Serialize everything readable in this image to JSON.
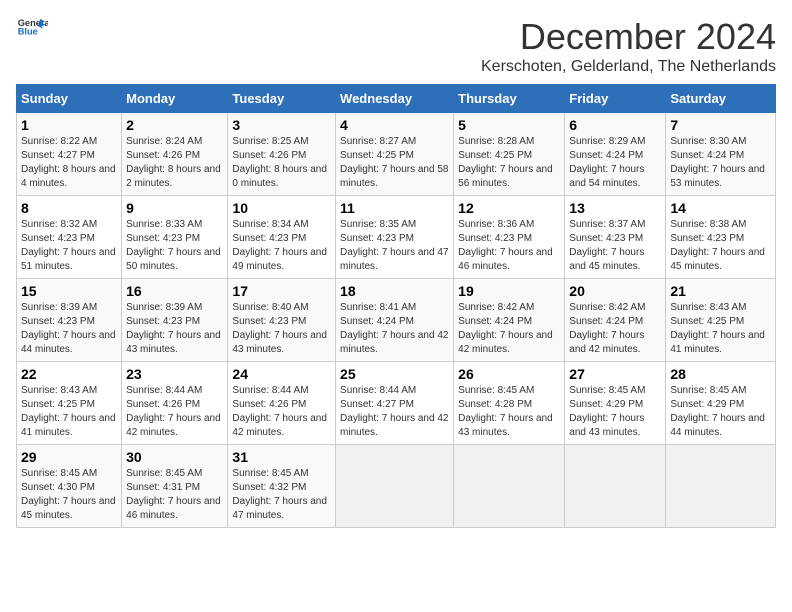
{
  "header": {
    "logo_general": "General",
    "logo_blue": "Blue",
    "title": "December 2024",
    "subtitle": "Kerschoten, Gelderland, The Netherlands"
  },
  "days_of_week": [
    "Sunday",
    "Monday",
    "Tuesday",
    "Wednesday",
    "Thursday",
    "Friday",
    "Saturday"
  ],
  "weeks": [
    [
      {
        "day": "1",
        "sunrise": "Sunrise: 8:22 AM",
        "sunset": "Sunset: 4:27 PM",
        "daylight": "Daylight: 8 hours and 4 minutes."
      },
      {
        "day": "2",
        "sunrise": "Sunrise: 8:24 AM",
        "sunset": "Sunset: 4:26 PM",
        "daylight": "Daylight: 8 hours and 2 minutes."
      },
      {
        "day": "3",
        "sunrise": "Sunrise: 8:25 AM",
        "sunset": "Sunset: 4:26 PM",
        "daylight": "Daylight: 8 hours and 0 minutes."
      },
      {
        "day": "4",
        "sunrise": "Sunrise: 8:27 AM",
        "sunset": "Sunset: 4:25 PM",
        "daylight": "Daylight: 7 hours and 58 minutes."
      },
      {
        "day": "5",
        "sunrise": "Sunrise: 8:28 AM",
        "sunset": "Sunset: 4:25 PM",
        "daylight": "Daylight: 7 hours and 56 minutes."
      },
      {
        "day": "6",
        "sunrise": "Sunrise: 8:29 AM",
        "sunset": "Sunset: 4:24 PM",
        "daylight": "Daylight: 7 hours and 54 minutes."
      },
      {
        "day": "7",
        "sunrise": "Sunrise: 8:30 AM",
        "sunset": "Sunset: 4:24 PM",
        "daylight": "Daylight: 7 hours and 53 minutes."
      }
    ],
    [
      {
        "day": "8",
        "sunrise": "Sunrise: 8:32 AM",
        "sunset": "Sunset: 4:23 PM",
        "daylight": "Daylight: 7 hours and 51 minutes."
      },
      {
        "day": "9",
        "sunrise": "Sunrise: 8:33 AM",
        "sunset": "Sunset: 4:23 PM",
        "daylight": "Daylight: 7 hours and 50 minutes."
      },
      {
        "day": "10",
        "sunrise": "Sunrise: 8:34 AM",
        "sunset": "Sunset: 4:23 PM",
        "daylight": "Daylight: 7 hours and 49 minutes."
      },
      {
        "day": "11",
        "sunrise": "Sunrise: 8:35 AM",
        "sunset": "Sunset: 4:23 PM",
        "daylight": "Daylight: 7 hours and 47 minutes."
      },
      {
        "day": "12",
        "sunrise": "Sunrise: 8:36 AM",
        "sunset": "Sunset: 4:23 PM",
        "daylight": "Daylight: 7 hours and 46 minutes."
      },
      {
        "day": "13",
        "sunrise": "Sunrise: 8:37 AM",
        "sunset": "Sunset: 4:23 PM",
        "daylight": "Daylight: 7 hours and 45 minutes."
      },
      {
        "day": "14",
        "sunrise": "Sunrise: 8:38 AM",
        "sunset": "Sunset: 4:23 PM",
        "daylight": "Daylight: 7 hours and 45 minutes."
      }
    ],
    [
      {
        "day": "15",
        "sunrise": "Sunrise: 8:39 AM",
        "sunset": "Sunset: 4:23 PM",
        "daylight": "Daylight: 7 hours and 44 minutes."
      },
      {
        "day": "16",
        "sunrise": "Sunrise: 8:39 AM",
        "sunset": "Sunset: 4:23 PM",
        "daylight": "Daylight: 7 hours and 43 minutes."
      },
      {
        "day": "17",
        "sunrise": "Sunrise: 8:40 AM",
        "sunset": "Sunset: 4:23 PM",
        "daylight": "Daylight: 7 hours and 43 minutes."
      },
      {
        "day": "18",
        "sunrise": "Sunrise: 8:41 AM",
        "sunset": "Sunset: 4:24 PM",
        "daylight": "Daylight: 7 hours and 42 minutes."
      },
      {
        "day": "19",
        "sunrise": "Sunrise: 8:42 AM",
        "sunset": "Sunset: 4:24 PM",
        "daylight": "Daylight: 7 hours and 42 minutes."
      },
      {
        "day": "20",
        "sunrise": "Sunrise: 8:42 AM",
        "sunset": "Sunset: 4:24 PM",
        "daylight": "Daylight: 7 hours and 42 minutes."
      },
      {
        "day": "21",
        "sunrise": "Sunrise: 8:43 AM",
        "sunset": "Sunset: 4:25 PM",
        "daylight": "Daylight: 7 hours and 41 minutes."
      }
    ],
    [
      {
        "day": "22",
        "sunrise": "Sunrise: 8:43 AM",
        "sunset": "Sunset: 4:25 PM",
        "daylight": "Daylight: 7 hours and 41 minutes."
      },
      {
        "day": "23",
        "sunrise": "Sunrise: 8:44 AM",
        "sunset": "Sunset: 4:26 PM",
        "daylight": "Daylight: 7 hours and 42 minutes."
      },
      {
        "day": "24",
        "sunrise": "Sunrise: 8:44 AM",
        "sunset": "Sunset: 4:26 PM",
        "daylight": "Daylight: 7 hours and 42 minutes."
      },
      {
        "day": "25",
        "sunrise": "Sunrise: 8:44 AM",
        "sunset": "Sunset: 4:27 PM",
        "daylight": "Daylight: 7 hours and 42 minutes."
      },
      {
        "day": "26",
        "sunrise": "Sunrise: 8:45 AM",
        "sunset": "Sunset: 4:28 PM",
        "daylight": "Daylight: 7 hours and 43 minutes."
      },
      {
        "day": "27",
        "sunrise": "Sunrise: 8:45 AM",
        "sunset": "Sunset: 4:29 PM",
        "daylight": "Daylight: 7 hours and 43 minutes."
      },
      {
        "day": "28",
        "sunrise": "Sunrise: 8:45 AM",
        "sunset": "Sunset: 4:29 PM",
        "daylight": "Daylight: 7 hours and 44 minutes."
      }
    ],
    [
      {
        "day": "29",
        "sunrise": "Sunrise: 8:45 AM",
        "sunset": "Sunset: 4:30 PM",
        "daylight": "Daylight: 7 hours and 45 minutes."
      },
      {
        "day": "30",
        "sunrise": "Sunrise: 8:45 AM",
        "sunset": "Sunset: 4:31 PM",
        "daylight": "Daylight: 7 hours and 46 minutes."
      },
      {
        "day": "31",
        "sunrise": "Sunrise: 8:45 AM",
        "sunset": "Sunset: 4:32 PM",
        "daylight": "Daylight: 7 hours and 47 minutes."
      },
      null,
      null,
      null,
      null
    ]
  ]
}
